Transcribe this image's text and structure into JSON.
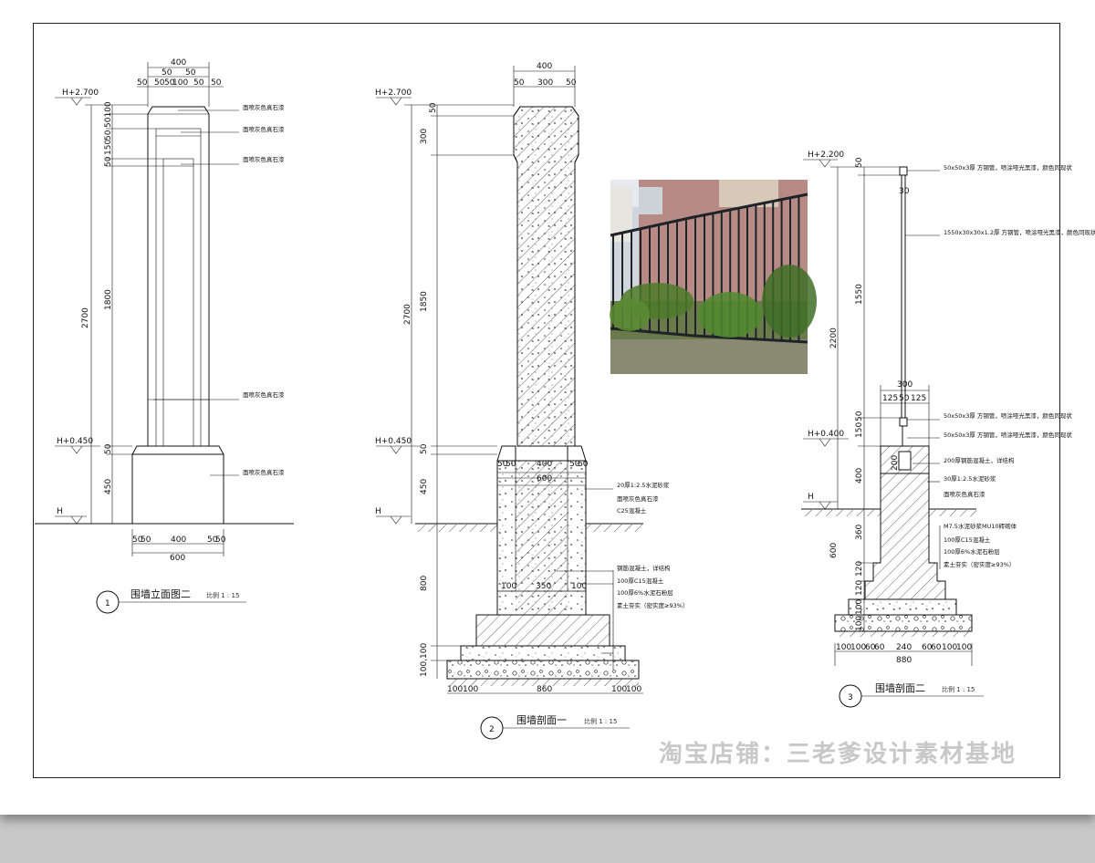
{
  "e1": {
    "levels": {
      "top": "H+2.700",
      "mid": "H+0.450",
      "ground": "H"
    },
    "dims_top": {
      "overall": "400",
      "inner_a": "50",
      "inner_b": "50",
      "row": [
        "50",
        "50",
        "50",
        "100",
        "50",
        "50"
      ]
    },
    "dims_left": {
      "d1": "2700",
      "d2": "1800",
      "d3": "450",
      "d4": "50",
      "top_stack": "50100",
      "d5": "50",
      "d6": "150",
      "d7": "50"
    },
    "dims_bottom": {
      "a": "50",
      "b": "50",
      "c": "400",
      "d": "50",
      "e": "50",
      "total": "600"
    },
    "labels": [
      "面喷灰色真石漆",
      "面喷灰色真石漆",
      "面喷灰色真石漆",
      "面喷灰色真石漆",
      "面喷灰色真石漆"
    ],
    "title": "围墙立面图二",
    "scale": "比例  1 : 15",
    "number": "1"
  },
  "s2": {
    "levels": {
      "top": "H+2.700",
      "mid": "H+0.450",
      "ground": "H"
    },
    "dims_top": {
      "overall": "400",
      "a": "50",
      "b": "300",
      "c": "50"
    },
    "dims_left": {
      "a": "50",
      "b": "300",
      "c": "1850",
      "d": "2700",
      "e": "50",
      "f": "450",
      "g": "800",
      "h": "100,100"
    },
    "dims_mid": {
      "a": "50",
      "b": "50",
      "c": "400",
      "d": "50",
      "e": "50",
      "f": "600"
    },
    "dims_footing": {
      "a": "100",
      "b": "350",
      "c": "100"
    },
    "dims_bottom": {
      "a": "100",
      "b": "100",
      "c": "860",
      "d": "100",
      "e": "100"
    },
    "labels": [
      "20厚1:2.5水泥砂浆",
      "面喷灰色真石漆",
      "C25混凝土",
      "钢筋混凝土，详结构",
      "100厚C15混凝土",
      "100厚6%水泥石粉层",
      "素土夯实（密实度≥93%）"
    ],
    "title": "围墙剖面一",
    "scale": "比例  1 : 15",
    "number": "2"
  },
  "s3": {
    "levels": {
      "top": "H+2.200",
      "mid": "H+0.400",
      "ground": "H"
    },
    "dims_left": {
      "a": "50",
      "b": "1550",
      "c": "2200",
      "d": "150",
      "e": "50",
      "f": "400",
      "g": "360",
      "h": "600",
      "i": "120",
      "j": "120",
      "k": "100",
      "l": "100"
    },
    "dims_post": {
      "a": "30",
      "total": "300",
      "b": "125",
      "c": "50",
      "d": "125",
      "e": "200"
    },
    "dims_bottom": {
      "row": [
        "100",
        "100",
        "60",
        "60",
        "240",
        "60",
        "60",
        "100",
        "100"
      ],
      "total": "880"
    },
    "labels": [
      "50x50x3厚 方钢管，喷涂哑光黑漆，颜色同现状",
      "1550x30x30x1.2厚 方钢管，喷涂哑光黑漆，颜色同现状",
      "50x50x3厚 方钢管，喷涂哑光黑漆，颜色同现状",
      "50x50x3厚 方钢管，喷涂哑光黑漆，颜色同现状",
      "200厚钢筋混凝土，详结构",
      "30厚1:2.5水泥砂浆",
      "面喷灰色真石漆",
      "M7.5水泥砂浆MU10砖砌体",
      "100厚C15混凝土",
      "100厚6%水泥石粉层",
      "素土夯实（密实度≥93%）"
    ],
    "title": "围墙剖面二",
    "scale": "比例  1 : 15",
    "number": "3"
  },
  "watermark": "淘宝店铺：三老爹设计素材基地"
}
